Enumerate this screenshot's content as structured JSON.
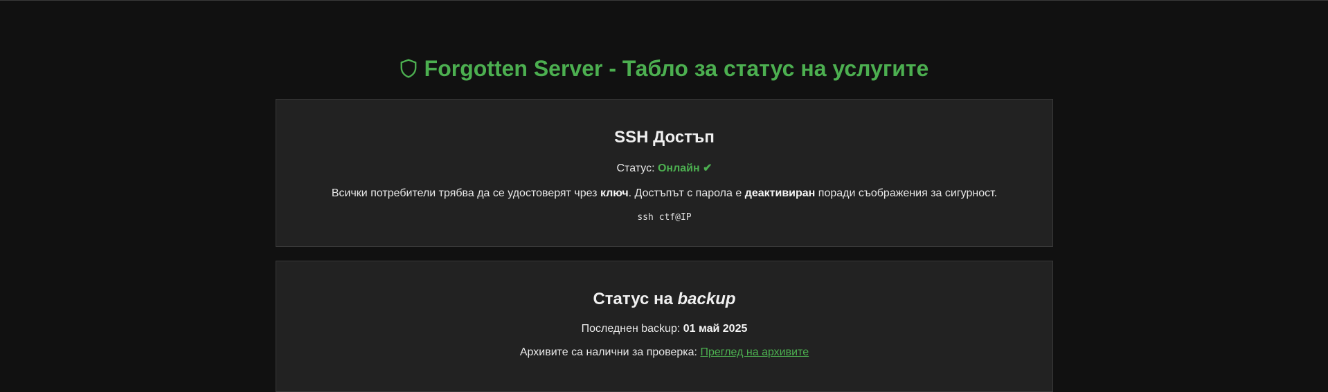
{
  "header": {
    "title": "Forgotten Server - Табло за статус на услугите",
    "icon": "shield-icon"
  },
  "colors": {
    "accent": "#4caf50",
    "background": "#111111",
    "card": "#222222"
  },
  "ssh": {
    "title": "SSH Достъп",
    "status_label": "Статус: ",
    "status_value": "Онлайн",
    "status_icon": "✔",
    "desc_part1": "Всички потребители трябва да се удостоверят чрез ",
    "desc_bold1": "ключ",
    "desc_part2": ". Достъпът с парола е ",
    "desc_bold2": "деактивиран",
    "desc_part3": " поради съображения за сигурност.",
    "command": "ssh ctf@IP"
  },
  "backup": {
    "title_prefix": "Статус на ",
    "title_em": "backup",
    "last_label": "Последнен backup: ",
    "last_value": "01 май 2025",
    "archives_label": "Архивите са налични за проверка: ",
    "archives_link": "Преглед на архивите"
  }
}
